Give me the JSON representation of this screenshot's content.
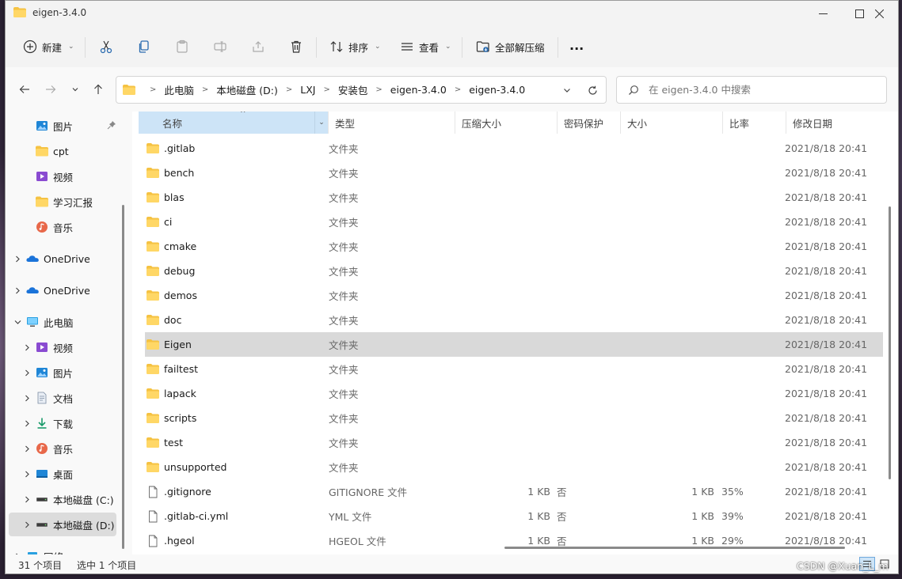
{
  "window": {
    "title": "eigen-3.4.0"
  },
  "toolbar": {
    "new_label": "新建",
    "sort_label": "排序",
    "view_label": "查看",
    "extract_all_label": "全部解压缩",
    "more_label": "..."
  },
  "address": {
    "breadcrumbs": [
      "此电脑",
      "本地磁盘 (D:)",
      "LXJ",
      "安装包",
      "eigen-3.4.0",
      "eigen-3.4.0"
    ]
  },
  "search": {
    "placeholder": "在 eigen-3.4.0 中搜索"
  },
  "sidebar": {
    "items": [
      {
        "label": "图片",
        "icon": "pictures-icon",
        "pinned": true
      },
      {
        "label": "cpt",
        "icon": "folder-icon"
      },
      {
        "label": "视频",
        "icon": "videos-icon"
      },
      {
        "label": "学习汇报",
        "icon": "folder-icon"
      },
      {
        "label": "音乐",
        "icon": "music-icon"
      },
      {
        "label": "OneDrive",
        "icon": "onedrive-icon",
        "expandable": true
      },
      {
        "label": "OneDrive",
        "icon": "onedrive-icon",
        "expandable": true
      },
      {
        "label": "此电脑",
        "icon": "this-pc-icon",
        "expanded": true
      },
      {
        "label": "视频",
        "icon": "videos-icon",
        "expandable": true
      },
      {
        "label": "图片",
        "icon": "pictures-icon",
        "expandable": true
      },
      {
        "label": "文档",
        "icon": "documents-icon",
        "expandable": true
      },
      {
        "label": "下载",
        "icon": "downloads-icon",
        "expandable": true
      },
      {
        "label": "音乐",
        "icon": "music-icon",
        "expandable": true
      },
      {
        "label": "桌面",
        "icon": "desktop-icon",
        "expandable": true
      },
      {
        "label": "本地磁盘 (C:)",
        "icon": "drive-icon",
        "expandable": true
      },
      {
        "label": "本地磁盘 (D:)",
        "icon": "drive-icon",
        "expandable": true,
        "selected": true
      },
      {
        "label": "网络",
        "icon": "network-icon",
        "expandable": true
      }
    ]
  },
  "columns": {
    "name": "名称",
    "type": "类型",
    "compressed_size": "压缩大小",
    "password": "密码保护",
    "size": "大小",
    "ratio": "比率",
    "modified": "修改日期"
  },
  "files": [
    {
      "name": ".gitlab",
      "type": "文件夹",
      "compressed": "",
      "password": "",
      "size": "",
      "ratio": "",
      "modified": "2021/8/18 20:41",
      "kind": "folder"
    },
    {
      "name": "bench",
      "type": "文件夹",
      "compressed": "",
      "password": "",
      "size": "",
      "ratio": "",
      "modified": "2021/8/18 20:41",
      "kind": "folder"
    },
    {
      "name": "blas",
      "type": "文件夹",
      "compressed": "",
      "password": "",
      "size": "",
      "ratio": "",
      "modified": "2021/8/18 20:41",
      "kind": "folder"
    },
    {
      "name": "ci",
      "type": "文件夹",
      "compressed": "",
      "password": "",
      "size": "",
      "ratio": "",
      "modified": "2021/8/18 20:41",
      "kind": "folder"
    },
    {
      "name": "cmake",
      "type": "文件夹",
      "compressed": "",
      "password": "",
      "size": "",
      "ratio": "",
      "modified": "2021/8/18 20:41",
      "kind": "folder"
    },
    {
      "name": "debug",
      "type": "文件夹",
      "compressed": "",
      "password": "",
      "size": "",
      "ratio": "",
      "modified": "2021/8/18 20:41",
      "kind": "folder"
    },
    {
      "name": "demos",
      "type": "文件夹",
      "compressed": "",
      "password": "",
      "size": "",
      "ratio": "",
      "modified": "2021/8/18 20:41",
      "kind": "folder"
    },
    {
      "name": "doc",
      "type": "文件夹",
      "compressed": "",
      "password": "",
      "size": "",
      "ratio": "",
      "modified": "2021/8/18 20:41",
      "kind": "folder"
    },
    {
      "name": "Eigen",
      "type": "文件夹",
      "compressed": "",
      "password": "",
      "size": "",
      "ratio": "",
      "modified": "2021/8/18 20:41",
      "kind": "folder",
      "selected": true
    },
    {
      "name": "failtest",
      "type": "文件夹",
      "compressed": "",
      "password": "",
      "size": "",
      "ratio": "",
      "modified": "2021/8/18 20:41",
      "kind": "folder"
    },
    {
      "name": "lapack",
      "type": "文件夹",
      "compressed": "",
      "password": "",
      "size": "",
      "ratio": "",
      "modified": "2021/8/18 20:41",
      "kind": "folder"
    },
    {
      "name": "scripts",
      "type": "文件夹",
      "compressed": "",
      "password": "",
      "size": "",
      "ratio": "",
      "modified": "2021/8/18 20:41",
      "kind": "folder"
    },
    {
      "name": "test",
      "type": "文件夹",
      "compressed": "",
      "password": "",
      "size": "",
      "ratio": "",
      "modified": "2021/8/18 20:41",
      "kind": "folder"
    },
    {
      "name": "unsupported",
      "type": "文件夹",
      "compressed": "",
      "password": "",
      "size": "",
      "ratio": "",
      "modified": "2021/8/18 20:41",
      "kind": "folder"
    },
    {
      "name": ".gitignore",
      "type": "GITIGNORE 文件",
      "compressed": "1 KB",
      "password": "否",
      "size": "1 KB",
      "ratio": "35%",
      "modified": "2021/8/18 20:41",
      "kind": "file"
    },
    {
      "name": ".gitlab-ci.yml",
      "type": "YML 文件",
      "compressed": "1 KB",
      "password": "否",
      "size": "1 KB",
      "ratio": "39%",
      "modified": "2021/8/18 20:41",
      "kind": "file"
    },
    {
      "name": ".hgeol",
      "type": "HGEOL 文件",
      "compressed": "1 KB",
      "password": "否",
      "size": "1 KB",
      "ratio": "29%",
      "modified": "2021/8/18 20:41",
      "kind": "file"
    }
  ],
  "status": {
    "item_count": "31 个项目",
    "selection": "选中 1 个项目"
  },
  "watermark": "CSDN @Xuan_L_m",
  "colors": {
    "folder": "#f5c242",
    "selection": "#d9d9d9",
    "sorted_header": "#cde4f7"
  }
}
